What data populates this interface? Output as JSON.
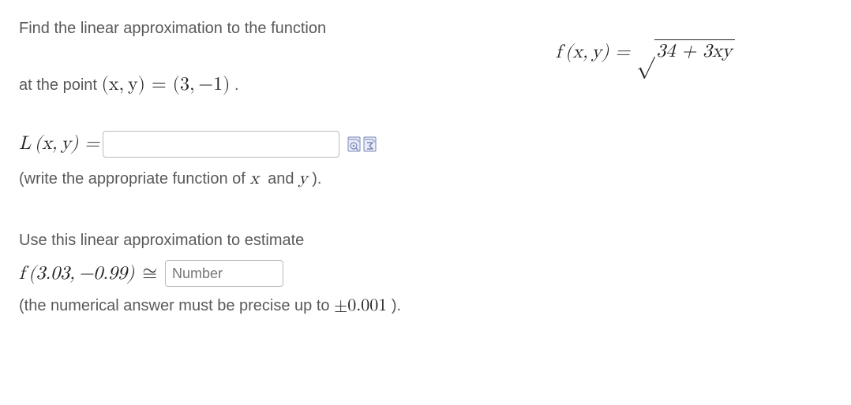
{
  "prompt1": "Find the linear approximation to the function",
  "formulaF_label": "f (x, y) = ",
  "formulaF_sqrt_content": "34 + 3xy",
  "promptAtPoint_pre": "at the point ",
  "promptAtPoint_math": "(x, y) = (3, −1)",
  "promptAtPoint_post": " .",
  "L_label": "L (x, y) = ",
  "input1_placeholder": "",
  "note1_pre": "(write the appropriate function of ",
  "note1_x": "x",
  "note1_mid": "  and ",
  "note1_y": "y",
  "note1_post": " ).",
  "prompt2": "Use this linear approximation to estimate",
  "lineF_eval": "f (3.03, −0.99)",
  "approx_sym": "≅",
  "input2_placeholder": "Number",
  "note2_pre": "(the numerical answer must be precise up to ",
  "note2_math": "±0.001",
  "note2_post": " )."
}
